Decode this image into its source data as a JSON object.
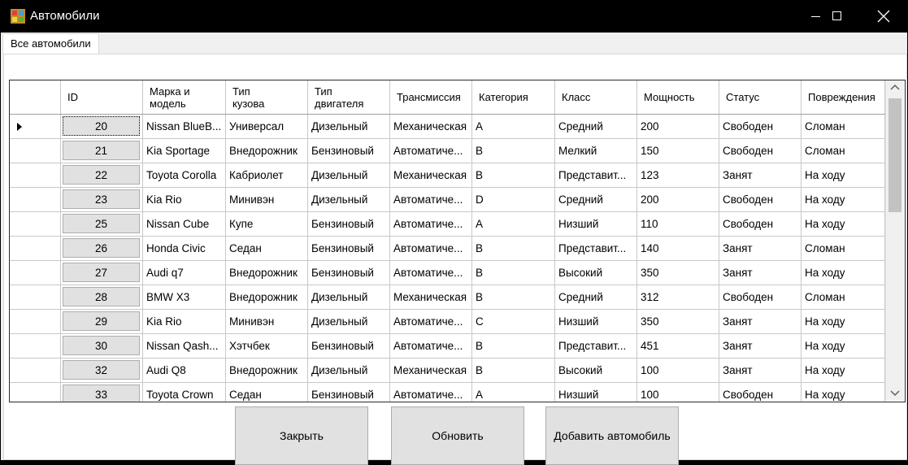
{
  "window": {
    "title": "Автомобили",
    "icon": "app-icon",
    "controls": [
      "minimize-icon",
      "maximize-icon",
      "close-icon"
    ]
  },
  "tabs": [
    {
      "label": "Все автомобили"
    }
  ],
  "grid": {
    "columns": [
      "ID",
      "Марка и модель",
      "Тип кузова",
      "Тип двигателя",
      "Трансмиссия",
      "Категория",
      "Класс",
      "Мощность",
      "Статус",
      "Повреждения"
    ],
    "columns_display": [
      "ID",
      "Марка и\nмодель",
      "Тип\nкузова",
      "Тип\nдвигателя",
      "Трансмиссия",
      "Категория",
      "Класс",
      "Мощность",
      "Статус",
      "Повреждения"
    ],
    "current_row_indicator": "triangle-right-icon",
    "rows": [
      [
        "20",
        "Nissan BlueB...",
        "Универсал",
        "Дизельный",
        "Механическая",
        "A",
        "Средний",
        "200",
        "Свободен",
        "Сломан"
      ],
      [
        "21",
        "Kia Sportage",
        "Внедорожник",
        "Бензиновый",
        "Автоматиче...",
        "B",
        "Мелкий",
        "150",
        "Свободен",
        "Сломан"
      ],
      [
        "22",
        "Toyota Corolla",
        "Кабриолет",
        "Дизельный",
        "Механическая",
        "B",
        "Представит...",
        "123",
        "Занят",
        "На ходу"
      ],
      [
        "23",
        "Kia Rio",
        "Минивэн",
        "Дизельный",
        "Автоматиче...",
        "D",
        "Средний",
        "200",
        "Свободен",
        "На ходу"
      ],
      [
        "25",
        "Nissan Cube",
        "Купе",
        "Бензиновый",
        "Автоматиче...",
        "A",
        "Низший",
        "110",
        "Свободен",
        "На ходу"
      ],
      [
        "26",
        "Honda Civic",
        "Седан",
        "Бензиновый",
        "Автоматиче...",
        "B",
        "Представит...",
        "140",
        "Занят",
        "Сломан"
      ],
      [
        "27",
        "Audi q7",
        "Внедорожник",
        "Бензиновый",
        "Автоматиче...",
        "B",
        "Высокий",
        "350",
        "Занят",
        "На ходу"
      ],
      [
        "28",
        "BMW X3",
        "Внедорожник",
        "Дизельный",
        "Механическая",
        "B",
        "Средний",
        "312",
        "Свободен",
        "Сломан"
      ],
      [
        "29",
        "Kia Rio",
        "Минивэн",
        "Дизельный",
        "Автоматиче...",
        "C",
        "Низший",
        "350",
        "Занят",
        "На ходу"
      ],
      [
        "30",
        "Nissan Qash...",
        "Хэтчбек",
        "Бензиновый",
        "Автоматиче...",
        "B",
        "Представит...",
        "451",
        "Занят",
        "На ходу"
      ],
      [
        "32",
        "Audi Q8",
        "Внедорожник",
        "Дизельный",
        "Механическая",
        "B",
        "Высокий",
        "100",
        "Занят",
        "На ходу"
      ],
      [
        "33",
        "Toyota Crown",
        "Седан",
        "Бензиновый",
        "Автоматиче...",
        "A",
        "Низший",
        "100",
        "Свободен",
        "На ходу"
      ]
    ]
  },
  "buttons": {
    "close_label": "Закрыть",
    "refresh_label": "Обновить",
    "add_label": "Добавить автомобиль"
  },
  "colors": {
    "titlebar": "#000000",
    "client": "#f0f0f0",
    "button_face": "#e1e1e1",
    "grid_line": "#c8c8c8"
  }
}
